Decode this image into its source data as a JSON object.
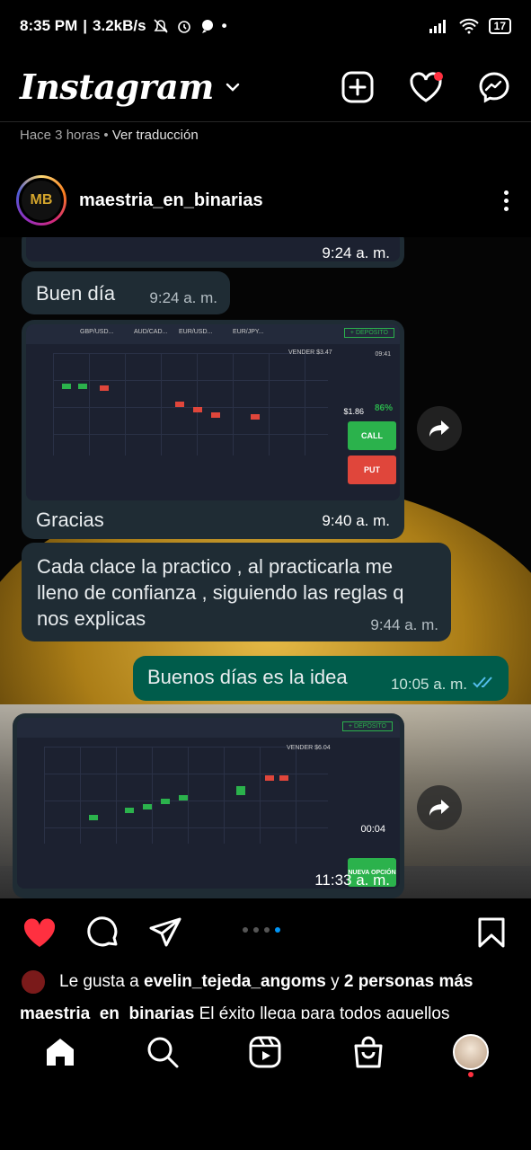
{
  "status_bar": {
    "time": "8:35 PM",
    "speed": "3.2kB/s",
    "battery": "17"
  },
  "app": {
    "title": "Instagram"
  },
  "prev_post": {
    "age": "Hace 3 horas",
    "translate": "Ver traducción"
  },
  "post": {
    "username": "maestria_en_binarias",
    "carousel": {
      "count": 4,
      "active": 4
    }
  },
  "chat": {
    "shot1_time": "9:24 a. m.",
    "msg1": {
      "text": "Buen día",
      "time": "9:24 a. m."
    },
    "shot2": {
      "assets": [
        "GBP/USD...",
        "AUD/CAD...",
        "EUR/USD...",
        "EUR/JPY..."
      ],
      "deposit": "+ DEPÓSITO",
      "sell": "VENDER $3.47",
      "amount": "$1.86",
      "pct": "86%",
      "call": "CALL",
      "put": "PUT",
      "clock": "09:41",
      "caption": "Gracias",
      "time": "9:40 a. m."
    },
    "msg3": {
      "text": "Cada clace la practico , al practicarla me lleno de confianza , siguiendo las reglas q nos explicas",
      "time": "9:44 a. m."
    },
    "msg4": {
      "text": "Buenos días es la idea",
      "time": "10:05 a. m."
    },
    "shot3": {
      "deposit": "+ DEPÓSITO",
      "sell": "VENDER $6.04",
      "timer": "00:04",
      "new_option": "NUEVA OPCIÓN",
      "time": "11:33 a. m."
    }
  },
  "likes": {
    "prefix": "Le gusta a",
    "user": "evelin_tejeda_angoms",
    "joiner": "y",
    "others": "2 personas más"
  },
  "caption": {
    "user": "maestria_en_binarias",
    "text": "El éxito llega para todos aquellos"
  },
  "icons": {
    "header": [
      "new-post-icon",
      "heart-icon",
      "messenger-icon"
    ],
    "actions": [
      "like-icon",
      "comment-icon",
      "share-icon",
      "save-icon"
    ],
    "nav": [
      "home-icon",
      "search-icon",
      "reels-icon",
      "shop-icon",
      "profile-avatar"
    ]
  },
  "colors": {
    "like_red": "#ff3040",
    "carousel_active": "#0095f6",
    "bubble_in": "#1f2c34",
    "bubble_out": "#005c4b"
  }
}
